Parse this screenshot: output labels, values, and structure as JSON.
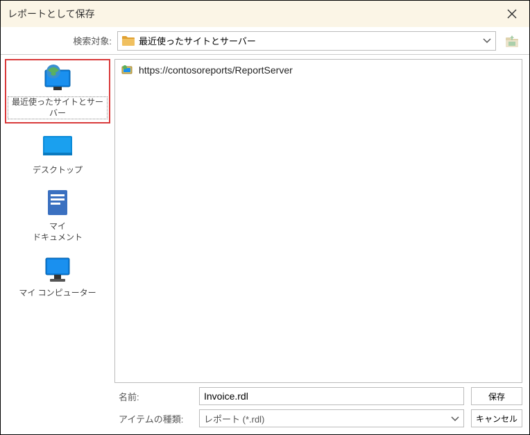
{
  "title": "レポートとして保存",
  "toolbar": {
    "search_label": "検索対象:",
    "location_text": "最近使ったサイトとサーバー"
  },
  "places": {
    "recent": "最近使ったサイトとサーバー",
    "desktop": "デスクトップ",
    "mydocs_line1": "マイ",
    "mydocs_line2": "ドキュメント",
    "mycomputer": "マイ コンピューター"
  },
  "file_list": {
    "item0": "https://contosoreports/ReportServer"
  },
  "bottom": {
    "name_label": "名前:",
    "name_value": "Invoice.rdl",
    "type_label": "アイテムの種類:",
    "type_value": "レポート (*.rdl)",
    "save_button": "保存",
    "cancel_button": "キャンセル"
  }
}
